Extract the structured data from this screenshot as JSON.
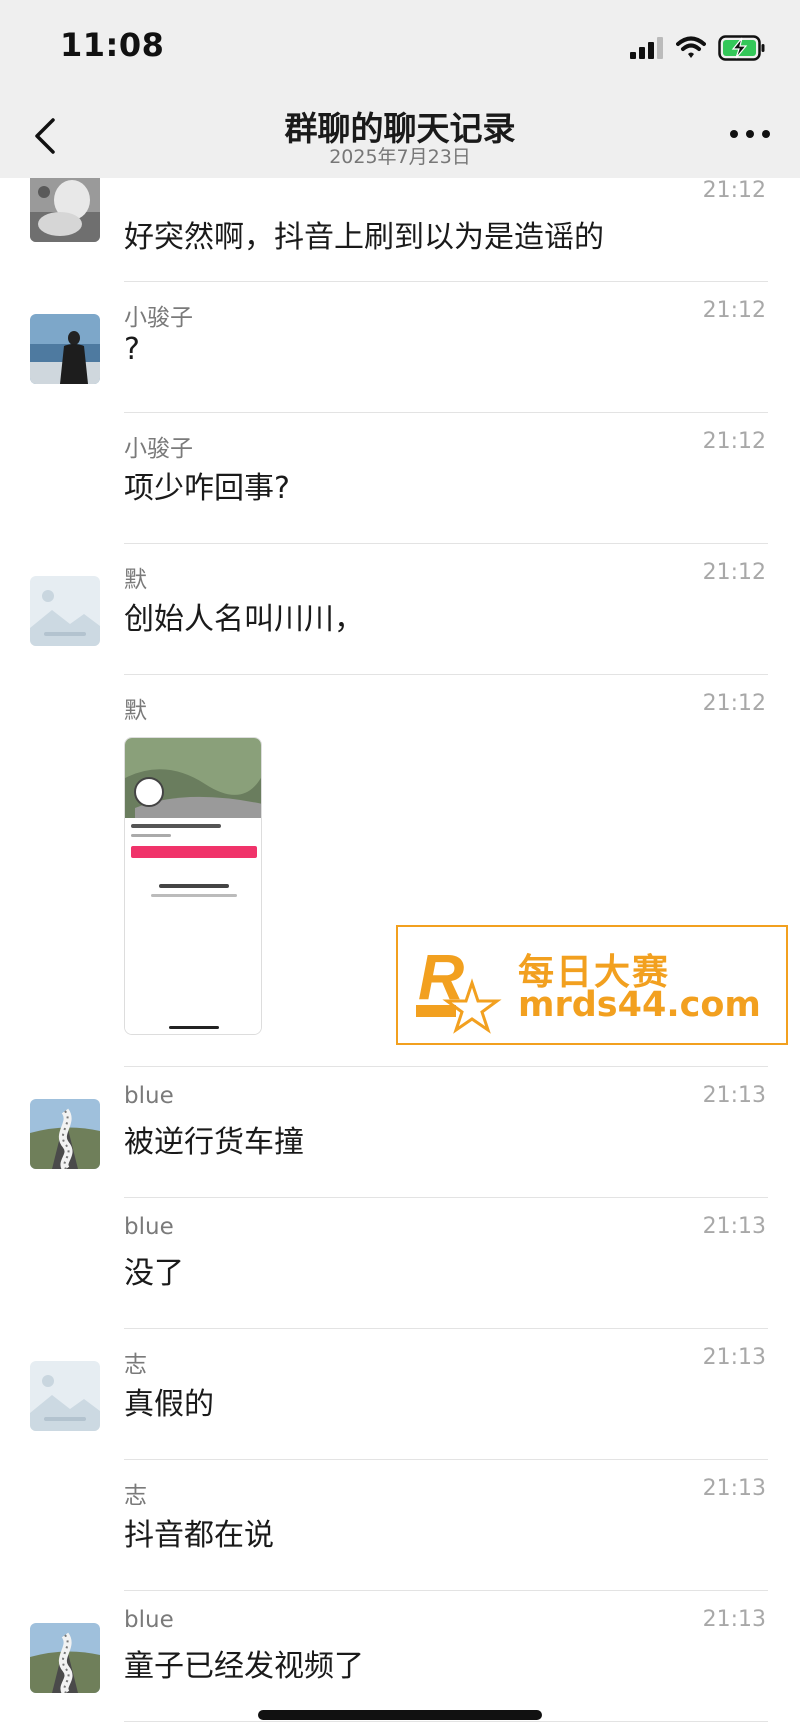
{
  "status_bar": {
    "time": "11:08"
  },
  "header": {
    "title": "群聊的聊天记录",
    "date": "2025年7月23日"
  },
  "messages": [
    {
      "sender": "",
      "time": "21:12",
      "text": "好突然啊，抖音上刷到以为是造谣的",
      "avatar": "gray-figure-avatar"
    },
    {
      "sender": "小骏子",
      "time": "21:12",
      "text": "?",
      "avatar": "seaside-person-avatar"
    },
    {
      "sender": "小骏子",
      "time": "21:12",
      "text": "项少咋回事?"
    },
    {
      "sender": "默",
      "time": "21:12",
      "text": "创始人名叫川川，",
      "avatar": "placeholder-image-avatar"
    },
    {
      "sender": "默",
      "time": "21:12",
      "text": "",
      "image": "phone-screenshot"
    },
    {
      "sender": "blue",
      "time": "21:13",
      "text": "被逆行货车撞",
      "avatar": "road-sculpture-avatar"
    },
    {
      "sender": "blue",
      "time": "21:13",
      "text": "没了"
    },
    {
      "sender": "志",
      "time": "21:13",
      "text": "真假的",
      "avatar": "placeholder-image-avatar"
    },
    {
      "sender": "志",
      "time": "21:13",
      "text": "抖音都在说"
    },
    {
      "sender": "blue",
      "time": "21:13",
      "text": "童子已经发视频了",
      "avatar": "road-sculpture-avatar"
    }
  ],
  "watermark": {
    "cn": "每日大赛",
    "url": "mrds44.com",
    "logo_letter": "R",
    "logo_small": "每日大赛"
  },
  "colors": {
    "bar_bg": "#efefef",
    "watermark": "#f2a01f",
    "accent_pink": "#f0336a"
  }
}
